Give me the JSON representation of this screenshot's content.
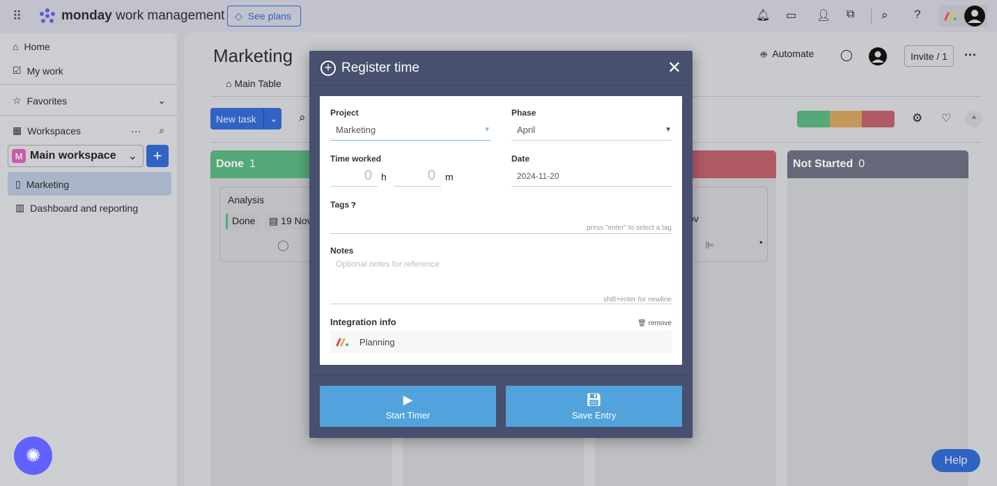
{
  "topbar": {
    "brand_bold": "monday",
    "brand_rest": " work management",
    "see_plans": "See plans"
  },
  "sidebar": {
    "home": "Home",
    "my_work": "My work",
    "favorites": "Favorites",
    "workspaces": "Workspaces",
    "workspace_name": "Main workspace",
    "workspace_initial": "M",
    "items": [
      {
        "label": "Marketing"
      },
      {
        "label": "Dashboard and reporting"
      }
    ]
  },
  "board": {
    "title": "Marketing",
    "tab_main_table": "Main Table",
    "new_task": "New task",
    "automate": "Automate",
    "invite": "Invite / 1",
    "columns": [
      {
        "name": "Done",
        "count": "1",
        "color": "#55a877"
      },
      {
        "name": "",
        "count": "",
        "color": "#b05a66"
      },
      {
        "name": "Not Started",
        "count": "0",
        "color": "#646878"
      }
    ],
    "card": {
      "title": "Analysis",
      "status": "Done",
      "date": "19 Nov",
      "date_fragment": "ov"
    },
    "progress_colors": [
      "#55a877",
      "#c49858",
      "#b05a66"
    ]
  },
  "modal": {
    "title": "Register time",
    "project_label": "Project",
    "project_value": "Marketing",
    "phase_label": "Phase",
    "phase_value": "April",
    "time_label": "Time worked",
    "hours": "0",
    "hours_unit": "h",
    "minutes": "0",
    "minutes_unit": "m",
    "date_label": "Date",
    "date_value": "2024-11-20",
    "tags_label": "Tags",
    "tags_hint": "press \"enter\" to select a tag",
    "notes_label": "Notes",
    "notes_placeholder": "Optional notes for reference",
    "notes_hint": "shift+enter for newline",
    "integration_label": "Integration info",
    "remove": "remove",
    "integration_value": "Planning",
    "start_timer": "Start Timer",
    "save_entry": "Save Entry"
  },
  "help": "Help"
}
